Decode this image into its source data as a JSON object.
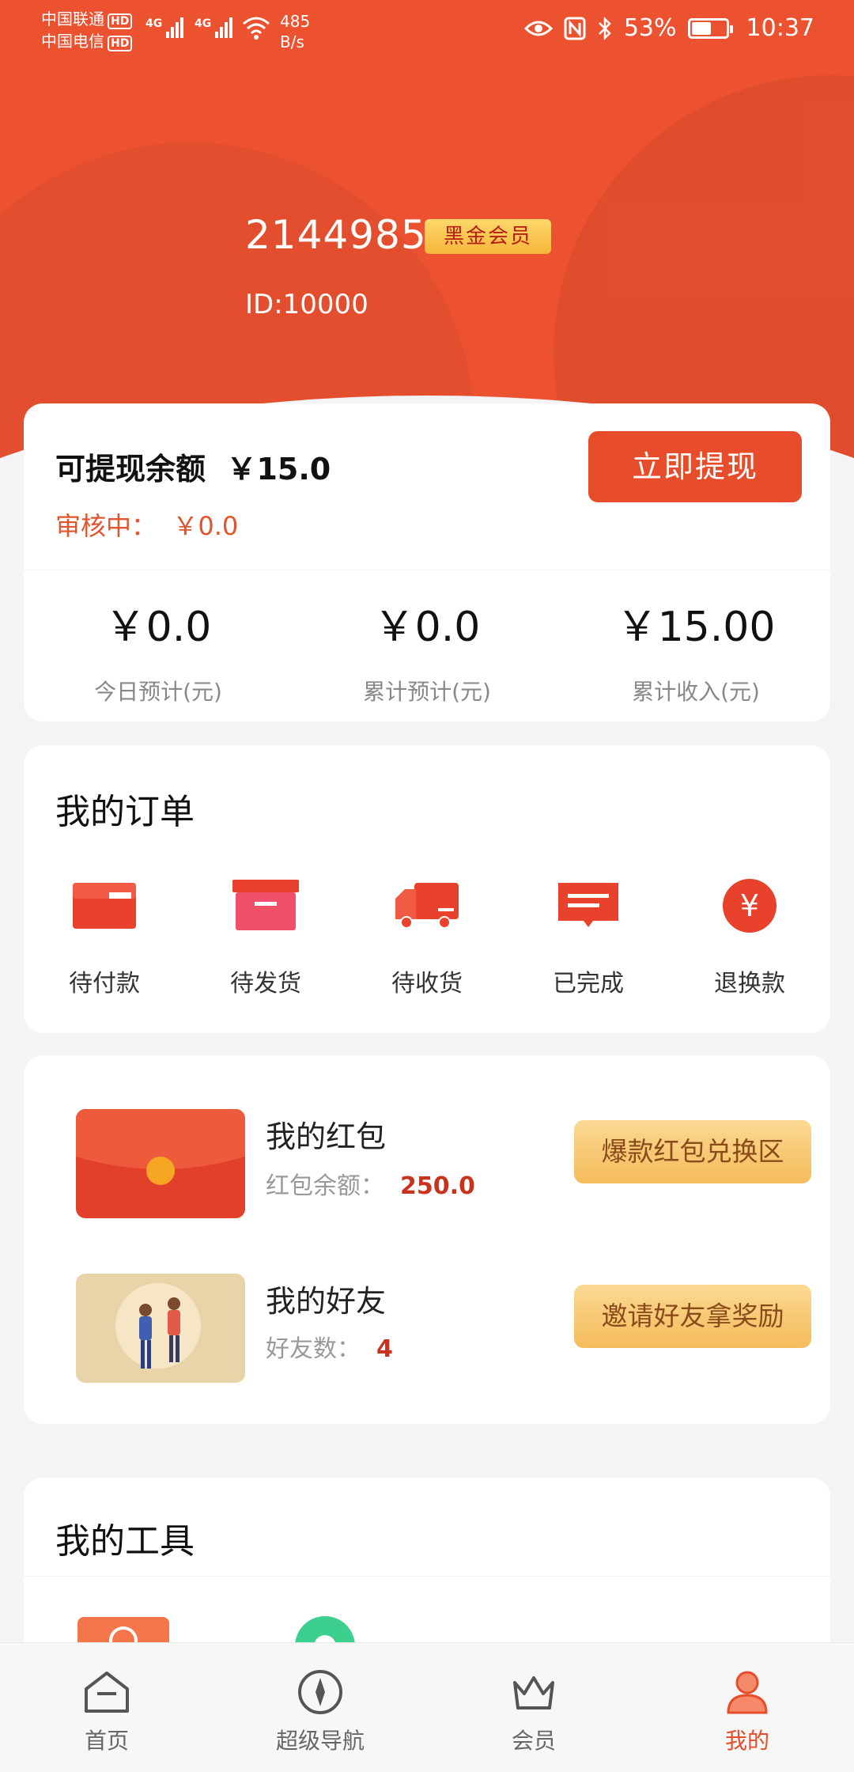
{
  "status_bar": {
    "carrier1": "中国联通",
    "carrier2": "中国电信",
    "hd": "HD",
    "net1": "4G",
    "net2": "4G",
    "speed_value": "485",
    "speed_unit": "B/s",
    "battery": "53%",
    "time": "10:37"
  },
  "profile": {
    "username": "2144985",
    "badge": "黑金会员",
    "id": "ID:10000"
  },
  "balance": {
    "title": "可提现余额  ￥15.0",
    "review": "审核中：  ￥0.0",
    "withdraw_button": "立即提现",
    "stats": [
      {
        "value": "￥0.0",
        "label": "今日预计(元)"
      },
      {
        "value": "￥0.0",
        "label": "累计预计(元)"
      },
      {
        "value": "￥15.00",
        "label": "累计收入(元)"
      }
    ]
  },
  "orders": {
    "title": "我的订单",
    "items": [
      {
        "label": "待付款",
        "icon": "wallet-icon"
      },
      {
        "label": "待发货",
        "icon": "box-icon"
      },
      {
        "label": "待收货",
        "icon": "truck-icon"
      },
      {
        "label": "已完成",
        "icon": "message-icon"
      },
      {
        "label": "退换款",
        "icon": "yen-icon"
      }
    ]
  },
  "promo": {
    "redpacket": {
      "title": "我的红包",
      "sub_label": "红包余额：",
      "sub_value": "250.0",
      "button": "爆款红包兑换区"
    },
    "friends": {
      "title": "我的好友",
      "sub_label": "好友数：",
      "sub_value": "4",
      "button": "邀请好友拿奖励"
    }
  },
  "tools": {
    "title": "我的工具"
  },
  "bottom_nav": [
    {
      "label": "首页",
      "icon": "home-icon"
    },
    {
      "label": "超级导航",
      "icon": "compass-icon"
    },
    {
      "label": "会员",
      "icon": "crown-icon"
    },
    {
      "label": "我的",
      "icon": "user-icon",
      "active": true
    }
  ],
  "colors": {
    "accent": "#ec5230",
    "badge_text": "#b51d13",
    "gold": "#f4bb5a"
  }
}
